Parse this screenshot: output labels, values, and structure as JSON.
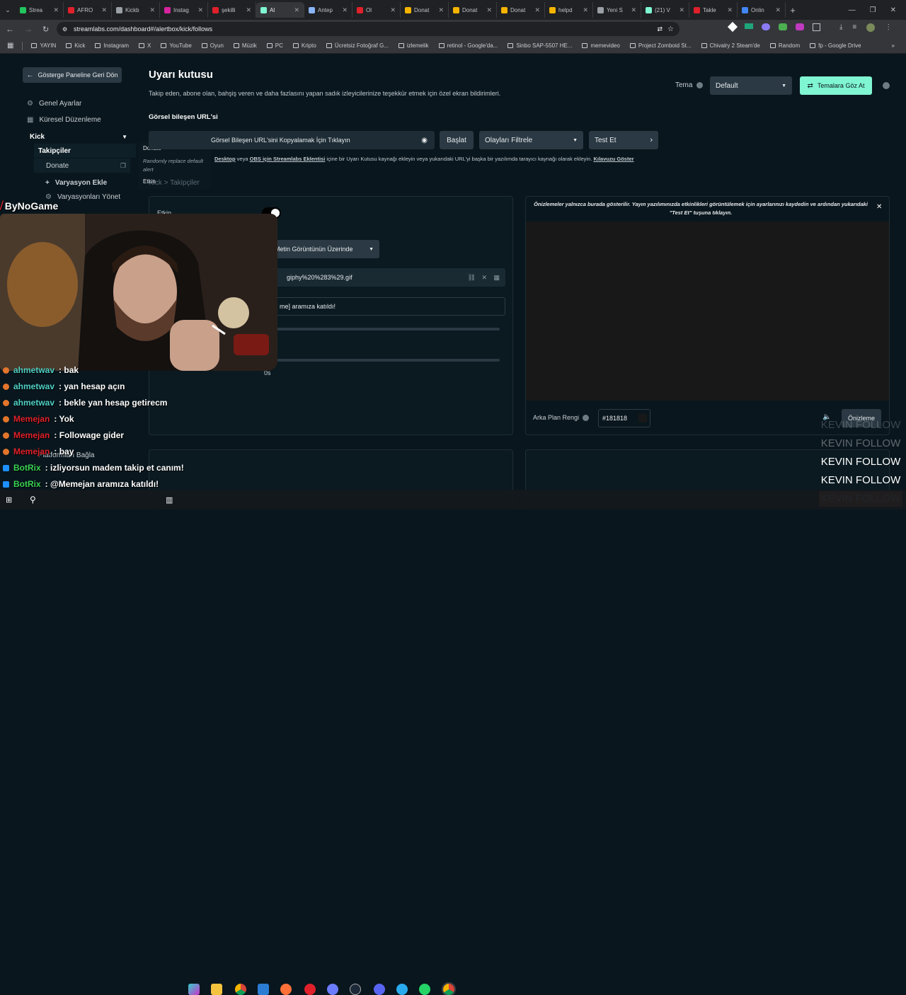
{
  "browser": {
    "tabs": [
      "Strea",
      "AFRO",
      "Kickb",
      "Instag",
      "şekilli",
      "Al",
      "Antep",
      "Ol",
      "Donat",
      "Donat",
      "Donat",
      "helpd",
      "Yeni S",
      "(21) V",
      "Takle",
      "Onlin"
    ],
    "new_tab": "+",
    "url": "streamlabs.com/dashboard#/alertbox/kick/follows",
    "bookmarks": [
      "YAYIN",
      "Kick",
      "Instagram",
      "X",
      "YouTube",
      "Oyun",
      "Müzik",
      "PC",
      "Kripto",
      "Ücretsiz Fotoğraf G...",
      "izlemelik",
      "retinol - Google'da...",
      "Sinbo SAP-5507 HE...",
      "memevideo",
      "Project Zomboid St...",
      "Chivalry 2 Steam'de",
      "Random",
      "fp - Google Drive"
    ]
  },
  "sidebar": {
    "back_button": "Gösterge Paneline Geri Dön",
    "items": [
      "Genel Ayarlar",
      "Küresel Düzenleme"
    ],
    "platform": "Kick",
    "sub_items": [
      "Takipçiler",
      "Donate"
    ],
    "add_variation": "Varyasyon Ekle",
    "manage_variations": "Varyasyonları Yönet",
    "bottom_item": "Platformları Bağla"
  },
  "popover": {
    "item1": "Donate",
    "desc": "Randomly replace default alert",
    "item2": "Etkin"
  },
  "header": {
    "title": "Uyarı kutusu",
    "subtitle": "Takip eden, abone olan, bahşiş veren ve daha fazlasını yapan sadık izleyicilerinize teşekkür etmek için özel ekran bildirimleri.",
    "theme_label": "Tema",
    "theme_value": "Default",
    "browse_themes": "Temalara Göz At"
  },
  "widget_url": {
    "label": "Görsel bileşen URL'si",
    "copy_text": "Görsel Bileşen URL'sini Kopyalamak İçin Tıklayın",
    "start": "Başlat",
    "filter": "Olayları Filtrele",
    "test": "Test Et",
    "help_prefix": "Desktop",
    "help_mid": " veya ",
    "help_link": "OBS için Streamlabs Eklentisi",
    "help_rest": " içine bir Uyarı Kutusu kaynağı ekleyin veya yukarıdaki URL'yi başka bir yazılımda tarayıcı kaynağı olarak ekleyin.",
    "guide_link": "Kılavuzu Göster"
  },
  "breadcrumb": "Kick > Takipçiler",
  "settings": {
    "enabled_label": "Etkin",
    "layout_value": "Metin Görüntünün Üzerinde",
    "file_name": "giphy%20%283%29.gif",
    "message_value": "me] aramıza katıldı!",
    "duration_value": "0s"
  },
  "preview": {
    "notice": "Önizlemeler yalnızca burada gösterilir. Yayın yazılımınızda etkinlikleri görüntülemek için ayarlarınızı kaydedin ve ardından yukarıdaki \"Test Et\" tuşuna tıklayın.",
    "bg_label": "Arka Plan Rengi",
    "bg_value": "#181818",
    "preview_button": "Önizleme"
  },
  "stream_overlay": {
    "logo": "ByNoGame",
    "chat": [
      {
        "user": "ahmetwav",
        "msg": ": bak",
        "color": "#4fd1c5"
      },
      {
        "user": "ahmetwav",
        "msg": ": yan hesap açın",
        "color": "#4fd1c5"
      },
      {
        "user": "ahmetwav",
        "msg": ": bekle yan hesap getirecm",
        "color": "#4fd1c5"
      },
      {
        "user": "Memejan",
        "msg": ": Yok",
        "color": "#e0202a"
      },
      {
        "user": "Memejan",
        "msg": ": Followage gider",
        "color": "#e0202a"
      },
      {
        "user": "Memejan",
        "msg": ": bay",
        "color": "#e0202a"
      },
      {
        "user": "BotRix",
        "msg": ": izliyorsun madem takip et canım!",
        "color": "#39d353"
      },
      {
        "user": "BotRix",
        "msg": ": @Memejan aramıza katıldı!",
        "color": "#39d353"
      }
    ],
    "kevin_follow": [
      "KEVIN FOLLOW",
      "KEVIN FOLLOW",
      "KEVIN FOLLOW",
      "KEVIN FOLLOW",
      "KEVIN FOLLOW"
    ]
  },
  "colors": {
    "accent": "#80f5d2",
    "page_bg": "#09161d",
    "kevin_orange": "#e8742a"
  }
}
